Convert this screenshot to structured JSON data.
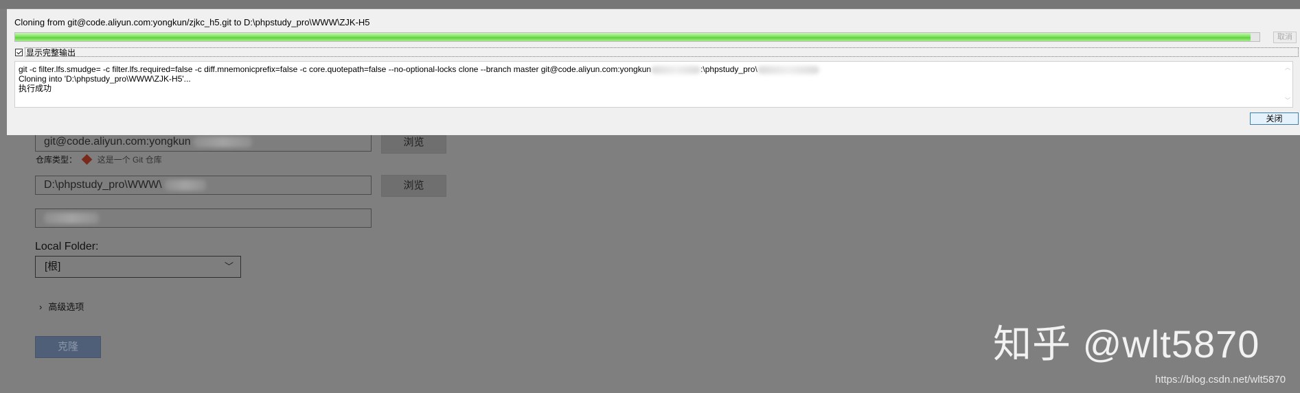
{
  "dialog": {
    "title": "Cloning from git@code.aliyun.com:yongkun/zjkc_h5.git to D:\\phpstudy_pro\\WWW\\ZJK-H5",
    "progress": 0.993,
    "cancel_label": "取消",
    "show_output_label": "显示完整输出",
    "show_output_checked": true,
    "output_lines": [
      {
        "text": "git -c filter.lfs.smudge= -c filter.lfs.required=false -c diff.mnemonicprefix=false -c core.quotepath=false --no-optional-locks clone --branch master git@code.aliyun.com:yongkun",
        "after": ":\\phpstudy_pro\\"
      },
      {
        "text": "Cloning into 'D:\\phpstudy_pro\\WWW\\ZJK-H5'..."
      },
      {
        "text": "执行成功"
      }
    ],
    "close_label": "关闭"
  },
  "clone_form": {
    "source_url": "git@code.aliyun.com:yongkun",
    "browse_label": "浏览",
    "repo_type_label": "仓库类型：",
    "repo_type_value": "这是一个 Git 仓库",
    "dest_path": "D:\\phpstudy_pro\\WWW\\",
    "local_folder_label": "Local Folder:",
    "local_folder_value": "[根]",
    "advanced_label": "高级选项",
    "clone_label": "克隆"
  },
  "watermark": "知乎 @wlt5870",
  "csdn_url": "https://blog.csdn.net/wlt5870",
  "colors": {
    "overlay": "#7f7f7f",
    "progress_green": "#5fd23c",
    "clone_button": "#4f5f78",
    "close_border": "#3c7fb1"
  }
}
